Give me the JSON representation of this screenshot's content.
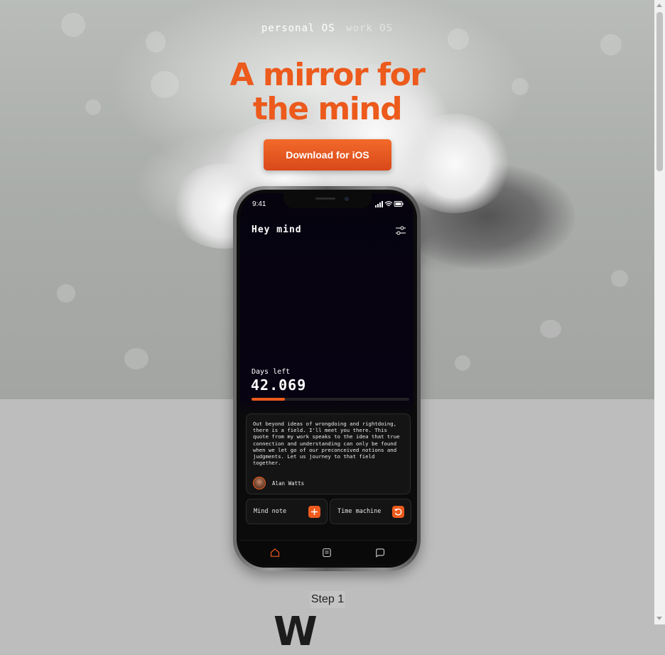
{
  "nav": {
    "tabs": [
      "personal OS",
      "work OS"
    ],
    "active_tab": "personal OS"
  },
  "hero": {
    "headline_line1": "A mirror for",
    "headline_line2": "the mind",
    "cta_label": "Download for iOS"
  },
  "phone": {
    "status_time": "9:41",
    "greeting": "Hey mind",
    "days_label": "Days left",
    "days_value": "42.069",
    "progress_fraction": 0.21,
    "quote": {
      "text": "Out beyond ideas of wrongdoing and rightdoing, there is a field. I'll meet you there. This quote from my work speaks to the idea that true connection and understanding can only be found when we let go of our preconceived notions and judgments. Let us journey to that field together.",
      "author": "Alan Watts"
    },
    "actions": [
      {
        "label": "Mind note",
        "icon": "plus-icon"
      },
      {
        "label": "Time machine",
        "icon": "history-icon"
      }
    ],
    "tabbar": [
      "home-icon",
      "notes-icon",
      "chat-icon"
    ]
  },
  "section": {
    "step_label": "Step 1",
    "heading": "W"
  },
  "colors": {
    "accent": "#ec5a1c",
    "screen_bg": "#06030f"
  }
}
